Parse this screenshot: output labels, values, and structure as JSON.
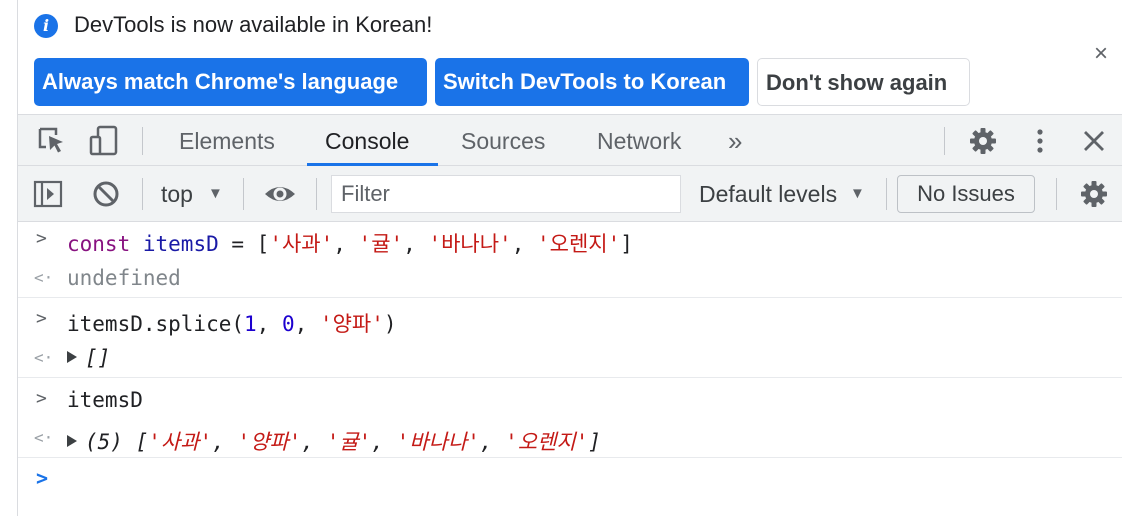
{
  "infobar": {
    "message": "DevTools is now available in Korean!",
    "btn_match": "Always match Chrome's language",
    "btn_switch": "Switch DevTools to Korean",
    "btn_dont_show": "Don't show again",
    "close": "×"
  },
  "tabs": {
    "elements": "Elements",
    "console": "Console",
    "sources": "Sources",
    "network": "Network",
    "more": "»"
  },
  "console_toolbar": {
    "context": "top",
    "filter_placeholder": "Filter",
    "levels": "Default levels",
    "issues": "No Issues"
  },
  "console": {
    "lines": [
      {
        "type": "input",
        "parts": [
          [
            "kw",
            "const"
          ],
          [
            "black",
            " "
          ],
          [
            "var",
            "itemsD"
          ],
          [
            "black",
            " = ["
          ],
          [
            "str",
            "'사과'"
          ],
          [
            "black",
            ", "
          ],
          [
            "str",
            "'귤'"
          ],
          [
            "black",
            ", "
          ],
          [
            "str",
            "'바나나'"
          ],
          [
            "black",
            ", "
          ],
          [
            "str",
            "'오렌지'"
          ],
          [
            "black",
            "]"
          ]
        ]
      },
      {
        "type": "output",
        "text": "undefined"
      },
      {
        "type": "input",
        "parts": [
          [
            "black",
            "itemsD.splice("
          ],
          [
            "num",
            "1"
          ],
          [
            "black",
            ", "
          ],
          [
            "num",
            "0"
          ],
          [
            "black",
            ", "
          ],
          [
            "str",
            "'양파'"
          ],
          [
            "black",
            ")"
          ]
        ]
      },
      {
        "type": "output_obj",
        "parts": [
          [
            "black",
            "[]"
          ]
        ]
      },
      {
        "type": "input",
        "parts": [
          [
            "black",
            "itemsD"
          ]
        ]
      },
      {
        "type": "output_obj",
        "parts": [
          [
            "black",
            "(5) ["
          ],
          [
            "str",
            "'사과'"
          ],
          [
            "black",
            ", "
          ],
          [
            "str",
            "'양파'"
          ],
          [
            "black",
            ", "
          ],
          [
            "str",
            "'귤'"
          ],
          [
            "black",
            ", "
          ],
          [
            "str",
            "'바나나'"
          ],
          [
            "black",
            ", "
          ],
          [
            "str",
            "'오렌지'"
          ],
          [
            "black",
            "]"
          ]
        ]
      }
    ]
  },
  "colors": {
    "accent": "#1a73e8",
    "keyword": "#881280",
    "variable": "#1a1aa6",
    "string": "#c41a16",
    "number": "#1c00cf"
  },
  "icons": [
    "info-icon",
    "close-icon",
    "inspect-element-icon",
    "device-toolbar-icon",
    "more-tabs-icon",
    "settings-gear-icon",
    "kebab-menu-icon",
    "close-devtools-icon",
    "sidebar-toggle-icon",
    "clear-console-icon",
    "dropdown-caret-icon",
    "live-expression-eye-icon",
    "console-settings-gear-icon",
    "prompt-chevron-icon",
    "return-arrow-icon",
    "expand-triangle-icon"
  ]
}
